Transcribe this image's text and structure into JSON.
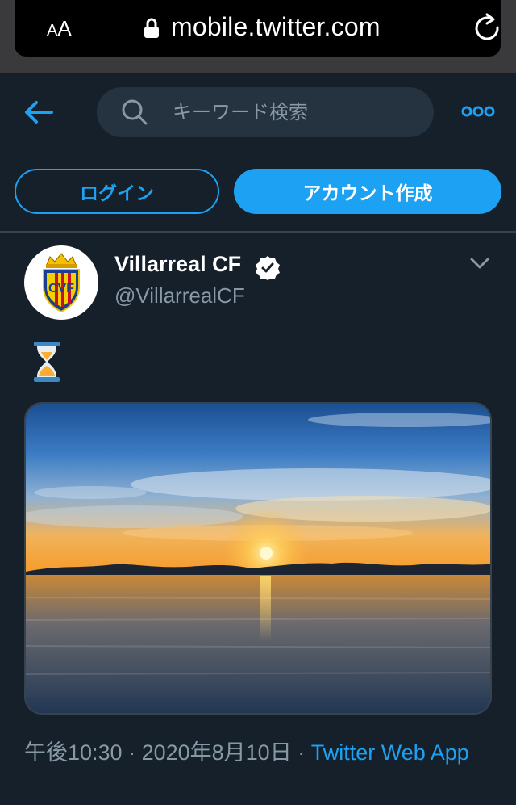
{
  "browser": {
    "text_size_small": "A",
    "text_size_big": "A",
    "url": "mobile.twitter.com"
  },
  "header": {
    "search_placeholder": "キーワード検索"
  },
  "auth": {
    "login_label": "ログイン",
    "signup_label": "アカウント作成"
  },
  "tweet": {
    "display_name": "Villarreal CF",
    "handle": "@VillarrealCF",
    "verified": true,
    "text_emoji": "hourglass",
    "media": "sunset-over-water-photo",
    "time": "午後10:30",
    "sep1": " · ",
    "date": "2020年8月10日",
    "sep2": " · ",
    "source": "Twitter Web App"
  },
  "colors": {
    "background": "#15202b",
    "accent": "#1da1f2",
    "secondary_text": "#8899a6",
    "border": "#38444d",
    "search_bg": "#253341"
  },
  "icons": [
    "lock-icon",
    "reload-icon",
    "back-arrow-icon",
    "search-icon",
    "more-icon",
    "verified-badge-icon",
    "chevron-down-icon"
  ]
}
